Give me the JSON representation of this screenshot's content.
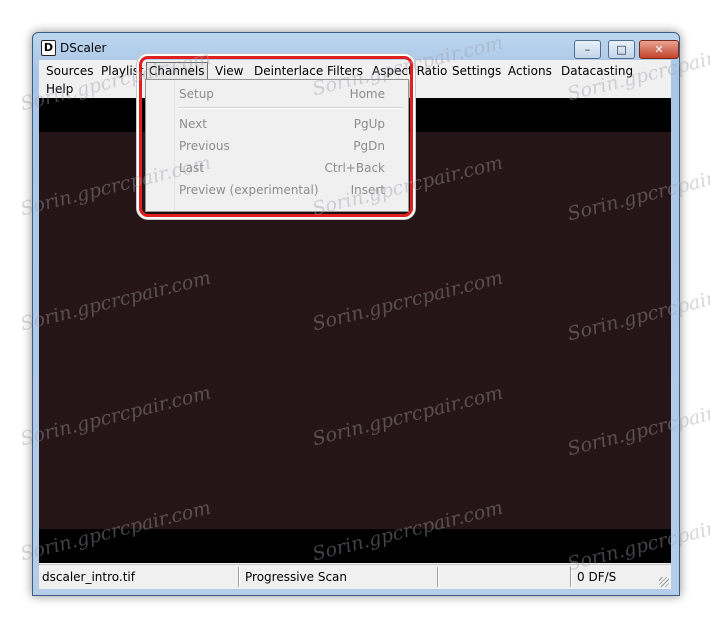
{
  "window": {
    "title": "DScaler",
    "icon_letter": "D"
  },
  "title_controls": {
    "minimize": "–",
    "maximize": "□",
    "close": "✕"
  },
  "menubar": {
    "items": [
      "Sources",
      "Playlist",
      "Channels",
      "View",
      "Deinterlace",
      "Filters",
      "Aspect Ratio",
      "Settings",
      "Actions",
      "Datacasting",
      "Help"
    ],
    "active": "Channels"
  },
  "dropdown": {
    "items": [
      {
        "label": "Setup",
        "shortcut": "Home"
      },
      {
        "label": "Next",
        "shortcut": "PgUp"
      },
      {
        "label": "Previous",
        "shortcut": "PgDn"
      },
      {
        "label": "Last",
        "shortcut": "Ctrl+Back"
      },
      {
        "label": "Preview (experimental)",
        "shortcut": "Insert"
      }
    ]
  },
  "statusbar": {
    "file": "dscaler_intro.tif",
    "scan_mode": "Progressive Scan",
    "empty_cell": "",
    "frames": "0 DF/S"
  },
  "watermark": {
    "text": "Sorin.gpcrcpair.com"
  },
  "colors": {
    "video_background": "#261516",
    "highlight_border": "#e02020"
  }
}
